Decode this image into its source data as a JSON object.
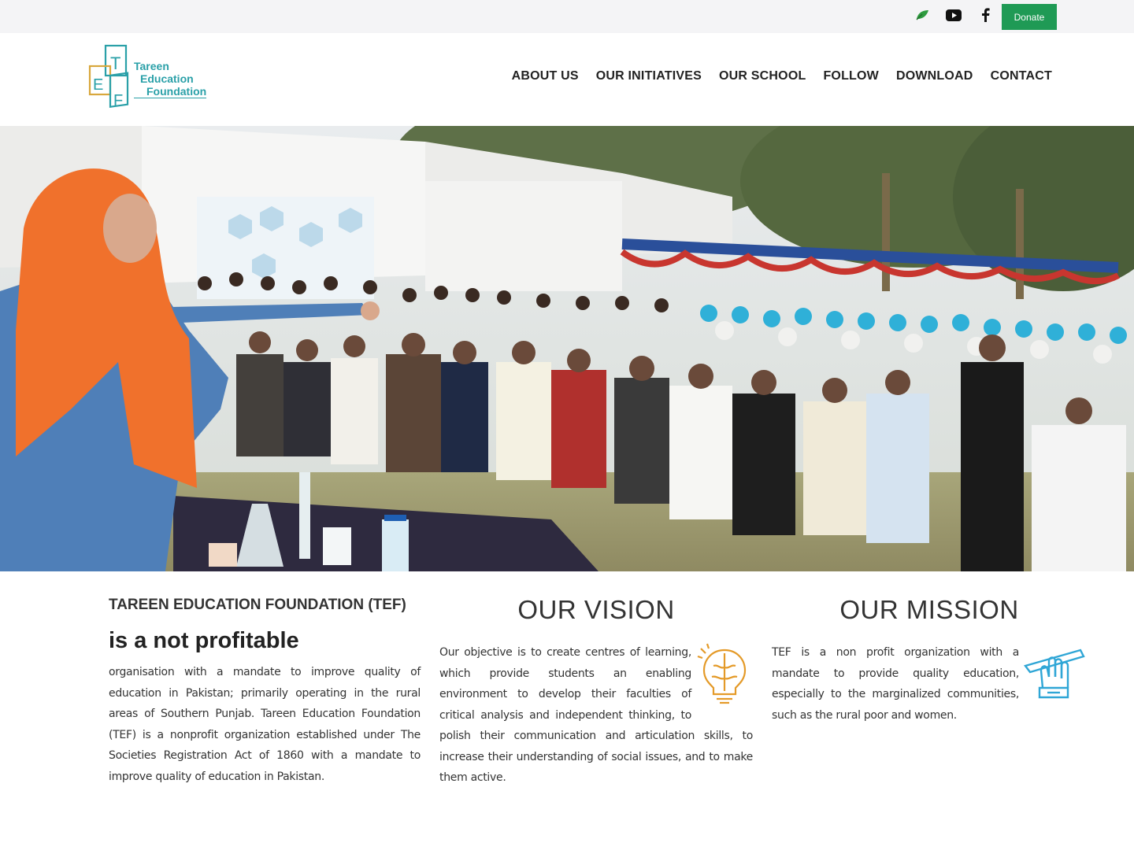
{
  "topbar": {
    "icons": [
      "leaf-icon",
      "youtube-icon",
      "facebook-icon",
      "twitter-icon",
      "instagram-icon"
    ],
    "donate_label": "Donate",
    "colors": {
      "bar_bg": "#f4f4f6",
      "donate_bg": "#1f9a55"
    }
  },
  "header": {
    "logo": {
      "line1": "Tareen",
      "line2": "Education",
      "line3": "Foundation",
      "letters": "TEF"
    },
    "nav": [
      "ABOUT US",
      "OUR INITIATIVES",
      "OUR SCHOOL",
      "FOLLOW",
      "DOWNLOAD",
      "CONTACT"
    ]
  },
  "hero": {
    "alt": ""
  },
  "about": {
    "title": "TAREEN EDUCATION FOUNDATION (TEF)",
    "subtitle": "is a not profitable",
    "body": "organisation with a mandate to improve quality of education in Pakistan; primarily operating in the rural areas of Southern Punjab. Tareen Education Foundation (TEF) is a nonprofit organization established under The Societies Registration Act of 1860 with a mandate to improve quality of education in Pakistan."
  },
  "vision": {
    "title": "OUR VISION",
    "icon": "brain-lightbulb-icon",
    "body": "Our objective is to create centres of learning, which provide students an enabling environment to develop their faculties of critical analysis and independent thinking, to polish their communication and articulation skills, to increase their understanding of social issues, and to make them active."
  },
  "mission": {
    "title": "OUR MISSION",
    "icon": "hand-pen-icon",
    "body": "TEF is a non profit organization with a mandate to provide quality education, especially to the marginalized communities, such as the rural poor and women."
  }
}
